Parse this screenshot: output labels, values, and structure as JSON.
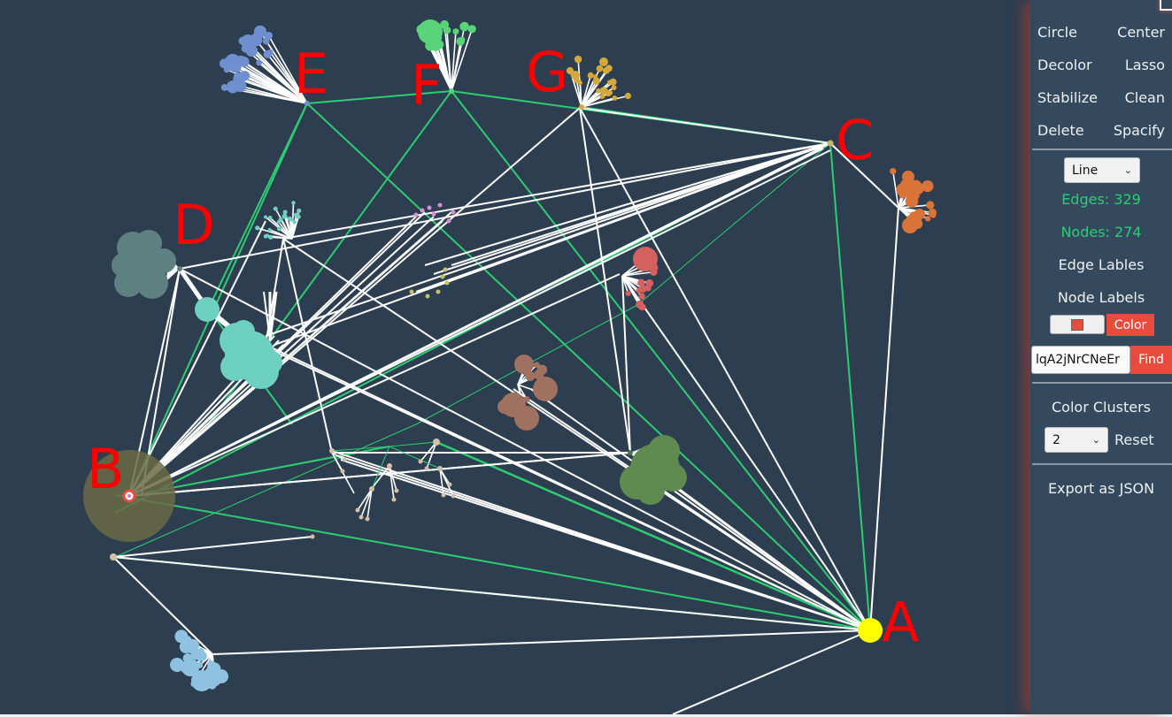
{
  "sidebar": {
    "buttons": [
      [
        "Circle",
        "Center"
      ],
      [
        "Decolor",
        "Lasso"
      ],
      [
        "Stabilize",
        "Clean"
      ],
      [
        "Delete",
        "Spacify"
      ]
    ],
    "edge_style_select": "Line",
    "edges_label": "Edges: 329",
    "nodes_label": "Nodes: 274",
    "edge_labels_toggle": "Edge Lables",
    "node_labels_toggle": "Node Labels",
    "color_swatch": "#e74c3c",
    "color_button": "Color",
    "find_input_value": "lqA2jNrCNeEr",
    "find_button": "Find",
    "color_clusters_label": "Color Clusters",
    "cluster_count_select": "2",
    "reset_button": "Reset",
    "export_button": "Export as JSON"
  },
  "graph": {
    "background": "#2c3e50",
    "edge_colors": {
      "default": "#ffffff",
      "highlight": "#2ecc71"
    },
    "labels": [
      {
        "text": "A",
        "hub": "A"
      },
      {
        "text": "B",
        "hub": "B"
      },
      {
        "text": "C",
        "hub": "C"
      },
      {
        "text": "D",
        "hub": "D"
      },
      {
        "text": "E",
        "hub": "E"
      },
      {
        "text": "F",
        "hub": "F"
      },
      {
        "text": "G",
        "hub": "G"
      }
    ],
    "hubs": {
      "A": {
        "color": "#ffff00",
        "role": "selected-node"
      },
      "B": {
        "color": "#e74c3c",
        "role": "highlighted-node",
        "halo": "#6b6a45"
      },
      "C": {
        "color": "#c8b56a"
      },
      "D": {
        "color": "#5f8080"
      },
      "E": {
        "color": "#6f8fd0"
      },
      "F": {
        "color": "#5ad47a"
      },
      "G": {
        "color": "#d4a83a"
      }
    },
    "clusters": [
      {
        "name": "E-cluster",
        "color": "#6f8fd0"
      },
      {
        "name": "F-cluster",
        "color": "#5ad47a"
      },
      {
        "name": "G-cluster",
        "color": "#d4a83a"
      },
      {
        "name": "orange-cluster",
        "color": "#d9733a"
      },
      {
        "name": "D-cluster",
        "color": "#5f8080"
      },
      {
        "name": "teal-cluster",
        "color": "#6dd0c0"
      },
      {
        "name": "teal-small-cluster",
        "color": "#6dd0c0"
      },
      {
        "name": "pink-cluster",
        "color": "#d78fd6"
      },
      {
        "name": "yellow-cluster",
        "color": "#c6c26a"
      },
      {
        "name": "red-cluster",
        "color": "#d46060"
      },
      {
        "name": "brown-cluster",
        "color": "#a07060"
      },
      {
        "name": "green-cluster",
        "color": "#5f8a50"
      },
      {
        "name": "tan-cluster",
        "color": "#d6bfa8"
      },
      {
        "name": "lightblue-cluster",
        "color": "#8fc2e0"
      }
    ]
  }
}
